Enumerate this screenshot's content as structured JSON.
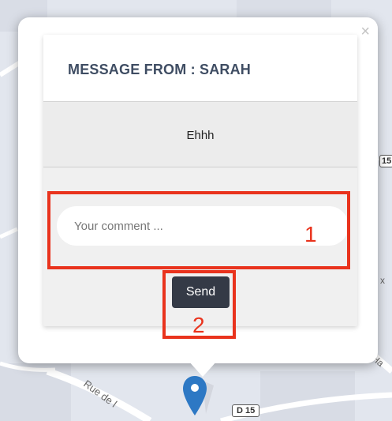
{
  "popup": {
    "close_label": "×",
    "title": "MESSAGE FROM : SARAH",
    "message": "Ehhh",
    "comment_placeholder": "Your comment ...",
    "send_label": "Send"
  },
  "annotations": [
    {
      "label": "1"
    },
    {
      "label": "2"
    }
  ],
  "map": {
    "road_name": "Rue de l",
    "road_name_right": "e Ha",
    "shield_bottom": "D 15",
    "shield_right": "15",
    "side_mark": "x"
  },
  "colors": {
    "accent": "#3f4d63",
    "button": "#343a46",
    "annotation": "#e9331d",
    "marker": "#2d78c4"
  },
  "icons": {
    "close": "close-icon",
    "marker": "map-marker-icon"
  }
}
